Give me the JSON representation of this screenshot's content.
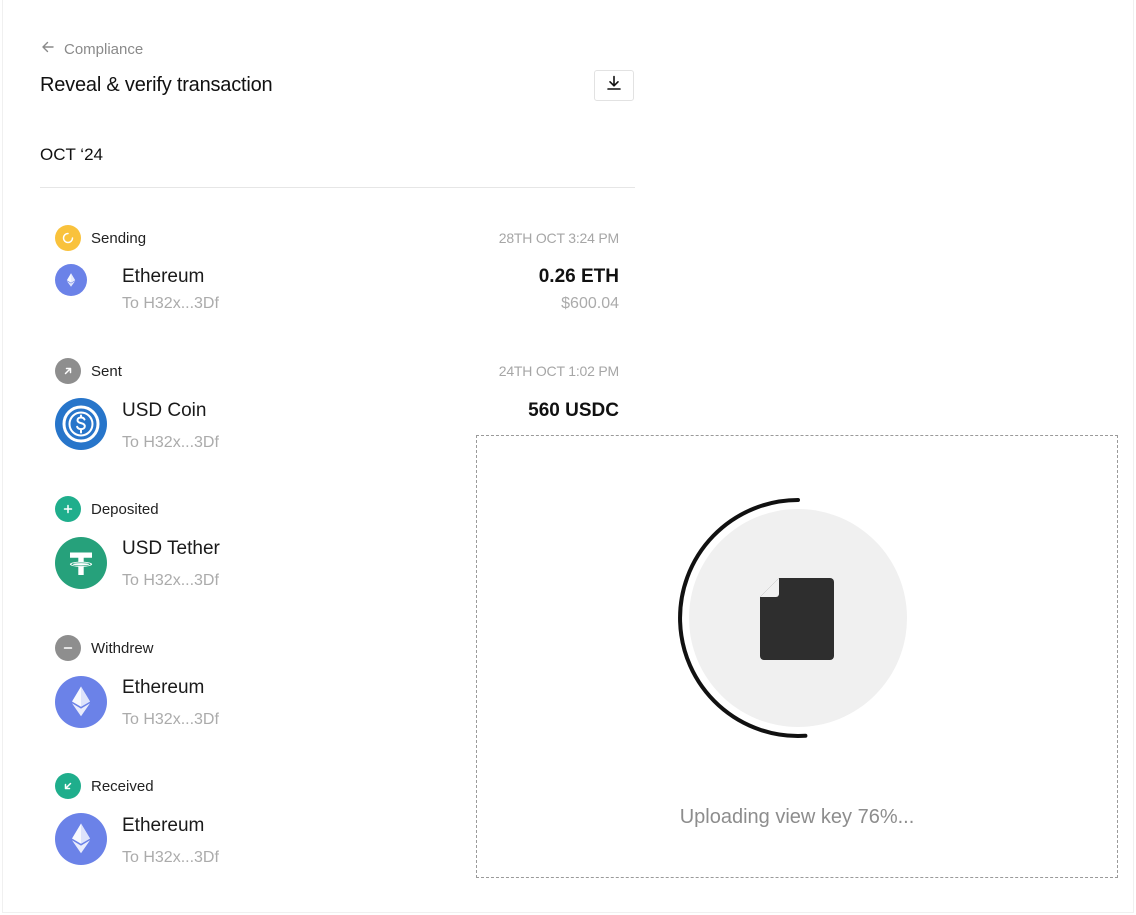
{
  "nav": {
    "back_label": "Compliance"
  },
  "page": {
    "title": "Reveal & verify transaction",
    "month": "OCT ‘24"
  },
  "colors": {
    "sending": "#f9c23c",
    "neutral": "#8e8e8e",
    "deposit": "#1fae8c",
    "eth": "#6b82e8",
    "usdc": "#2775ca",
    "usdt": "#26a17b"
  },
  "transactions": [
    {
      "status": "Sending",
      "status_icon": "spinner-icon",
      "time": "28TH OCT 3:24 PM",
      "coin": "Ethereum",
      "coin_icon": "ethereum-icon",
      "to": "To H32x...3Df",
      "amount": "0.26 ETH",
      "fiat": "$600.04"
    },
    {
      "status": "Sent",
      "status_icon": "arrow-up-right-icon",
      "time": "24TH OCT 1:02 PM",
      "coin": "USD Coin",
      "coin_icon": "usd-coin-icon",
      "to": "To H32x...3Df",
      "amount": "560 USDC"
    },
    {
      "status": "Deposited",
      "status_icon": "plus-icon",
      "coin": "USD Tether",
      "coin_icon": "tether-icon",
      "to": "To H32x...3Df"
    },
    {
      "status": "Withdrew",
      "status_icon": "minus-icon",
      "coin": "Ethereum",
      "coin_icon": "ethereum-icon",
      "to": "To H32x...3Df"
    },
    {
      "status": "Received",
      "status_icon": "arrow-down-left-icon",
      "coin": "Ethereum",
      "coin_icon": "ethereum-icon",
      "to": "To H32x...3Df"
    }
  ],
  "upload": {
    "text": "Uploading view key 76%...",
    "progress": 0.76,
    "icon": "file-icon"
  }
}
